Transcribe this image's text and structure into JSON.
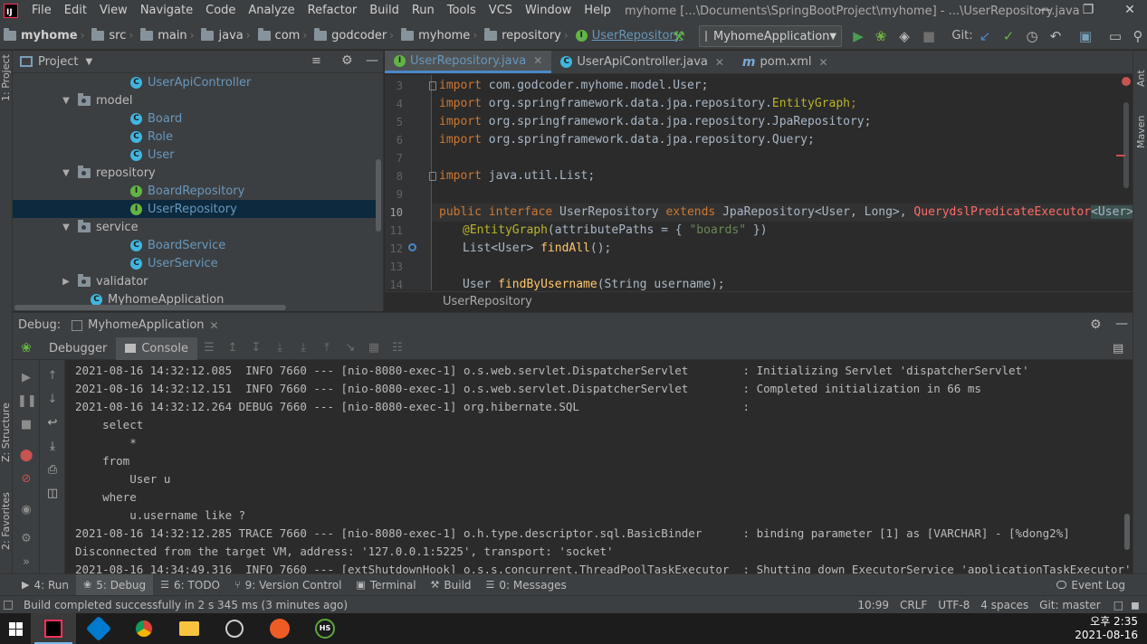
{
  "menubar": {
    "items": [
      "File",
      "Edit",
      "View",
      "Navigate",
      "Code",
      "Analyze",
      "Refactor",
      "Build",
      "Run",
      "Tools",
      "VCS",
      "Window",
      "Help"
    ],
    "title": "myhome [...\\Documents\\SpringBootProject\\myhome] - ...\\UserRepository.java"
  },
  "navbar": {
    "crumbs": [
      "myhome",
      "src",
      "main",
      "java",
      "com",
      "godcoder",
      "myhome",
      "repository"
    ],
    "current": "UserRepository",
    "run_config": "MyhomeApplication",
    "git_label": "Git:"
  },
  "left_strip": {
    "project": "1: Project",
    "structure": "Z: Structure",
    "favorites": "2: Favorites"
  },
  "right_strip": {
    "ant": "Ant",
    "maven": "Maven"
  },
  "project": {
    "title": "Project",
    "tree": [
      {
        "label": "UserApiController",
        "kind": "class",
        "indent": 3
      },
      {
        "label": "model",
        "kind": "folder",
        "indent": 2,
        "arrow": "down"
      },
      {
        "label": "Board",
        "kind": "class",
        "indent": 3
      },
      {
        "label": "Role",
        "kind": "class",
        "indent": 3
      },
      {
        "label": "User",
        "kind": "class",
        "indent": 3
      },
      {
        "label": "repository",
        "kind": "folder",
        "indent": 2,
        "arrow": "down"
      },
      {
        "label": "BoardRepository",
        "kind": "interface",
        "indent": 3
      },
      {
        "label": "UserRepository",
        "kind": "interface",
        "indent": 3,
        "selected": true
      },
      {
        "label": "service",
        "kind": "folder",
        "indent": 2,
        "arrow": "down"
      },
      {
        "label": "BoardService",
        "kind": "class",
        "indent": 3
      },
      {
        "label": "UserService",
        "kind": "class",
        "indent": 3
      },
      {
        "label": "validator",
        "kind": "folder",
        "indent": 2,
        "arrow": "right"
      },
      {
        "label": "MyhomeApplication",
        "kind": "class",
        "indent": 2
      }
    ]
  },
  "editor": {
    "tabs": [
      {
        "label": "UserRepository.java",
        "icon": "interface",
        "active": true
      },
      {
        "label": "UserApiController.java",
        "icon": "class",
        "active": false
      },
      {
        "label": "pom.xml",
        "icon": "maven",
        "active": false
      }
    ],
    "line_numbers": [
      "3",
      "4",
      "5",
      "6",
      "7",
      "8",
      "9",
      "10",
      "11",
      "12",
      "13",
      "14"
    ],
    "lines": {
      "l3_kw": "import",
      "l3_rest": " com.godcoder.myhome.model.User;",
      "l4_kw": "import",
      "l4_a": " org.springframework.data.jpa.repository.",
      "l4_b": "EntityGraph",
      "l4_c": ";",
      "l5_kw": "import",
      "l5_rest": " org.springframework.data.jpa.repository.JpaRepository;",
      "l6_kw": "import",
      "l6_rest": " org.springframework.data.jpa.repository.Query;",
      "l8_kw": "import",
      "l8_rest": " java.util.List;",
      "l10_a": "public interface",
      "l10_b": " UserRepository ",
      "l10_c": "extends",
      "l10_d": " JpaRepository<User, Long>, ",
      "l10_e": "QuerydslPredicateExecutor",
      "l10_f": "<User>",
      "l10_g": " {",
      "l11_a": "@EntityGraph",
      "l11_b": "(attributePaths = { ",
      "l11_c": "\"boards\"",
      "l11_d": " })",
      "l12_a": "List<User> ",
      "l12_b": "findAll",
      "l12_c": "();",
      "l14_a": "User ",
      "l14_b": "findByUsername",
      "l14_c": "(String username);"
    },
    "breadcrumb": "UserRepository"
  },
  "debug": {
    "label": "Debug:",
    "session": "MyhomeApplication",
    "tabs": [
      "Debugger",
      "Console"
    ],
    "console": [
      "2021-08-16 14:32:12.085  INFO 7660 --- [nio-8080-exec-1] o.s.web.servlet.DispatcherServlet        : Initializing Servlet 'dispatcherServlet'",
      "2021-08-16 14:32:12.151  INFO 7660 --- [nio-8080-exec-1] o.s.web.servlet.DispatcherServlet        : Completed initialization in 66 ms",
      "2021-08-16 14:32:12.264 DEBUG 7660 --- [nio-8080-exec-1] org.hibernate.SQL                        :",
      "    select",
      "        *",
      "    from",
      "        User u",
      "    where",
      "        u.username like ?",
      "2021-08-16 14:32:12.285 TRACE 7660 --- [nio-8080-exec-1] o.h.type.descriptor.sql.BasicBinder      : binding parameter [1] as [VARCHAR] - [%dong2%]",
      "Disconnected from the target VM, address: '127.0.0.1:5225', transport: 'socket'",
      "2021-08-16 14:34:49.316  INFO 7660 --- [extShutdownHook] o.s.s.concurrent.ThreadPoolTaskExecutor  : Shutting down ExecutorService 'applicationTaskExecutor'"
    ]
  },
  "toolwindows": [
    {
      "label": "4: Run",
      "active": false
    },
    {
      "label": "5: Debug",
      "active": true
    },
    {
      "label": "6: TODO",
      "active": false
    },
    {
      "label": "9: Version Control",
      "active": false
    },
    {
      "label": "Terminal",
      "active": false
    },
    {
      "label": "Build",
      "active": false
    },
    {
      "label": "0: Messages",
      "active": false
    }
  ],
  "event_log": "Event Log",
  "status": {
    "message": "Build completed successfully in 2 s 345 ms (3 minutes ago)",
    "position": "10:99",
    "line_sep": "CRLF",
    "encoding": "UTF-8",
    "indent": "4 spaces",
    "git": "Git: master"
  },
  "clock": {
    "time": "오후 2:35",
    "date": "2021-08-16"
  },
  "colors": {
    "accent": "#4a88c7",
    "run_green": "#499c54",
    "selection": "#0d293e",
    "keyword": "#cc7832",
    "string": "#6a8759"
  }
}
